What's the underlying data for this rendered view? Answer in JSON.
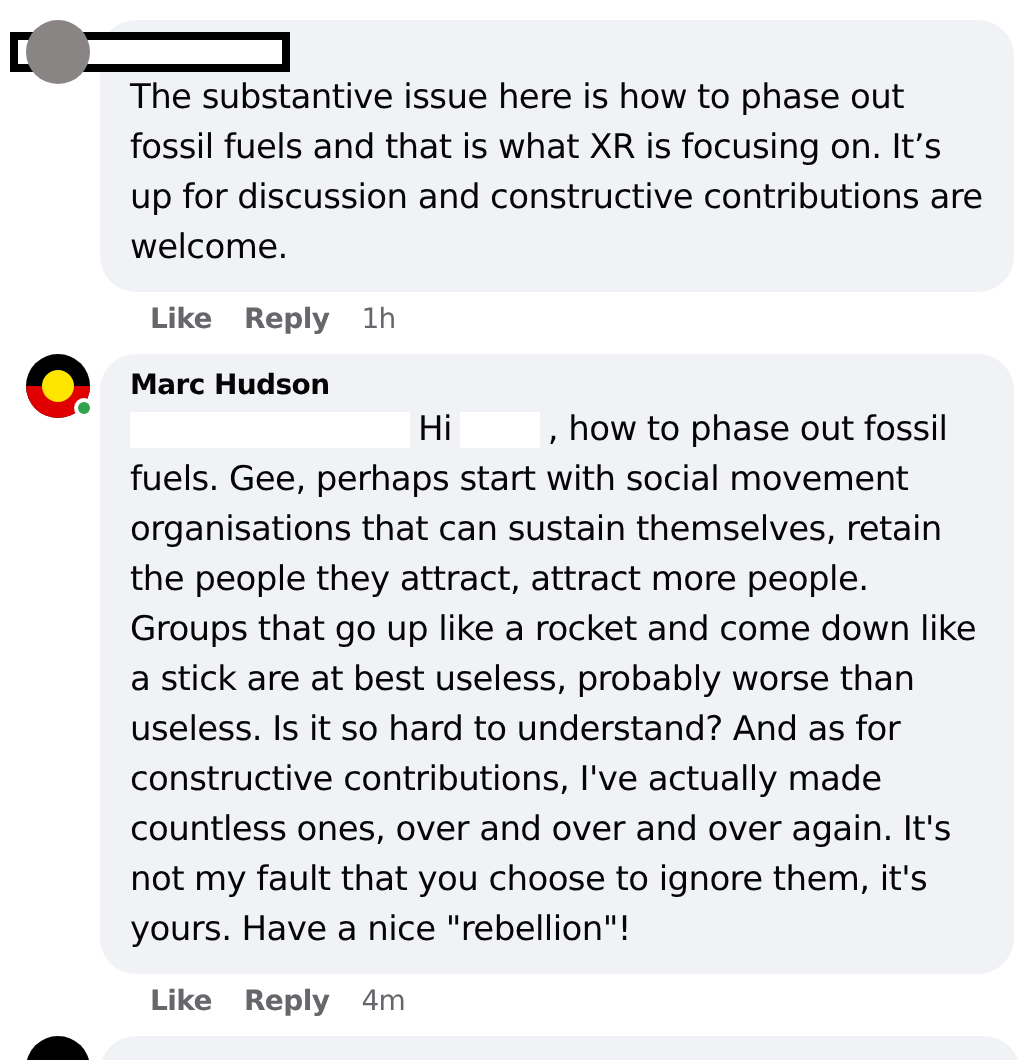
{
  "comments": [
    {
      "author_redacted": true,
      "avatar": {
        "kind": "photo"
      },
      "online": false,
      "body": [
        {
          "kind": "text",
          "text": "The substantive issue here is how to phase out fossil fuels and that is what XR is focusing on. It’s up for discussion and constructive contributions are welcome."
        }
      ],
      "actions": [
        "Like",
        "Reply"
      ],
      "time": "1h"
    },
    {
      "author": "Marc Hudson",
      "author_redacted": false,
      "avatar": {
        "kind": "flag"
      },
      "online": true,
      "body": [
        {
          "kind": "redaction"
        },
        {
          "kind": "text",
          "text": "Hi"
        },
        {
          "kind": "redaction"
        },
        {
          "kind": "text",
          "text": ", how to phase out fossil fuels. Gee, perhaps start with social movement organisations that can sustain themselves, retain the people they attract, attract more people. Groups that go up like a rocket and come down like a stick are at best useless, probably worse than useless. Is it so hard to understand? And as for constructive contributions, I've actually made countless ones, over and over and over again. It's not my fault that you choose to ignore them, it's yours. Have a nice \"rebellion\"!"
        }
      ],
      "actions": [
        "Like",
        "Reply"
      ],
      "time": "4m"
    }
  ]
}
